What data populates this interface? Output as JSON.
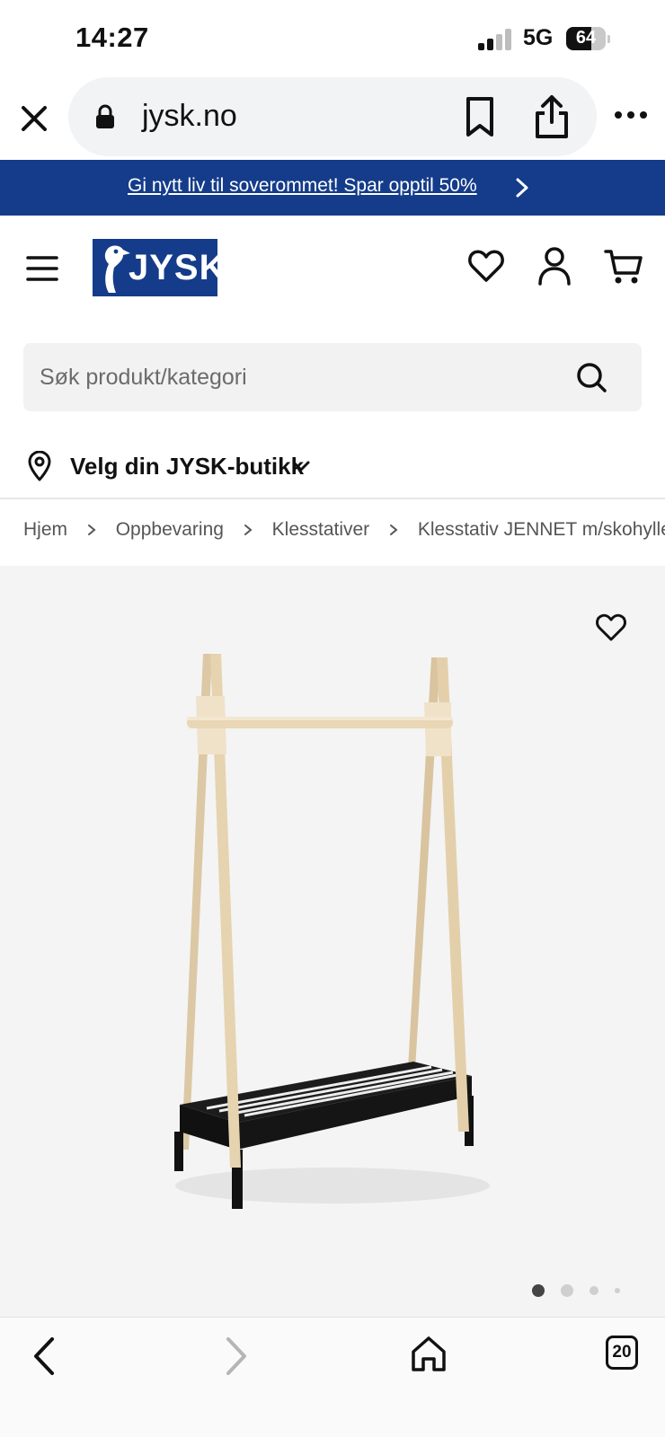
{
  "status_bar": {
    "time": "14:27",
    "network": "5G",
    "battery": "64",
    "battery_level": 0.64
  },
  "browser": {
    "url": "jysk.no",
    "icons": [
      "close-icon",
      "lock-icon",
      "bookmark-icon",
      "share-icon",
      "more-icon"
    ]
  },
  "promo": {
    "text": "Gi nytt liv til soverommet! Spar opptil 50%",
    "background": "#143c8a"
  },
  "header": {
    "logo": "JYSK",
    "brand_color": "#143c8a",
    "icons": [
      "menu-icon",
      "heart-icon",
      "account-icon",
      "cart-icon"
    ]
  },
  "search": {
    "placeholder": "Søk produkt/kategori",
    "value": ""
  },
  "store": {
    "label": "Velg din JYSK-butikk"
  },
  "breadcrumb": {
    "items": [
      "Hjem",
      "Oppbevaring",
      "Klesstativer",
      "Klesstativ JENNET m/skohylle"
    ]
  },
  "gallery": {
    "image_count": 4,
    "active_index": 0
  },
  "bottom_nav": {
    "tabs_count": "20"
  }
}
